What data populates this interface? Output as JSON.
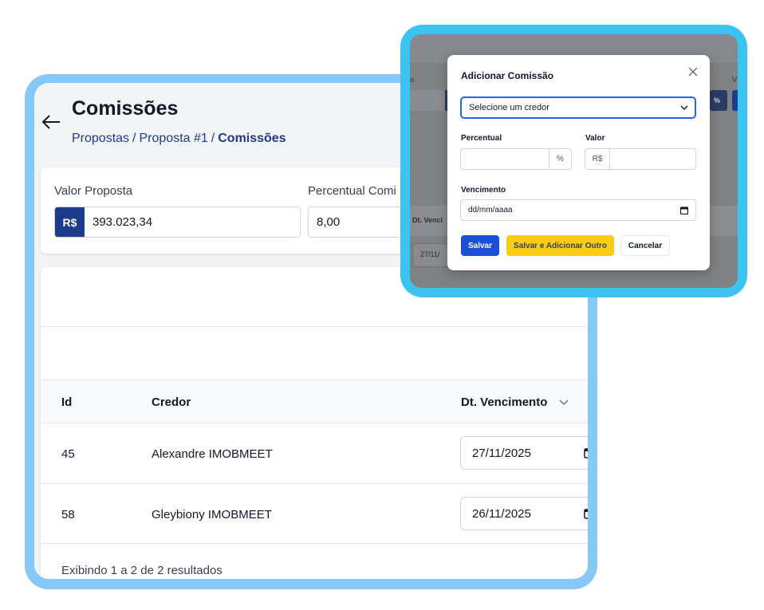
{
  "page": {
    "title": "Comissões",
    "breadcrumb": {
      "items": [
        "Propostas",
        "Proposta #1"
      ],
      "separator": "/",
      "current": "Comissões"
    }
  },
  "summary": {
    "valor_proposta_label": "Valor Proposta",
    "currency_addon": "R$",
    "valor_proposta_value": "393.023,34",
    "percentual_label": "Percentual Comi",
    "percentual_value": "8,00"
  },
  "table": {
    "columns": [
      "Id",
      "Credor",
      "Dt. Vencimento"
    ],
    "rows": [
      {
        "id": "45",
        "credor": "Alexandre IMOBMEET",
        "vencimento": "27/11/2025"
      },
      {
        "id": "58",
        "credor": "Gleybiony IMOBMEET",
        "vencimento": "26/11/2025"
      }
    ],
    "footer": "Exibindo 1 a 2 de 2 resultados"
  },
  "modal": {
    "background": {
      "left_fragment": "o",
      "right_fragment": "V",
      "percent_addon": "%",
      "column_fragment": "Dt. Venci",
      "date_fragment": "27/11/"
    },
    "title": "Adicionar Comissão",
    "credor_placeholder": "Selecione um credor",
    "percentual_label": "Percentual",
    "percentual_addon": "%",
    "valor_label": "Valor",
    "valor_addon": "R$",
    "vencimento_label": "Vencimento",
    "vencimento_placeholder": "dd/mm/aaaa",
    "buttons": {
      "save": "Salvar",
      "save_add": "Salvar e Adicionar Outro",
      "cancel": "Cancelar"
    }
  },
  "colors": {
    "frame_back": "#86c9f8",
    "frame_modal": "#3bc4f2",
    "brand_navy": "#1e3a8a",
    "primary": "#1d4ed8",
    "warning": "#facc15"
  },
  "icons": [
    "arrow-left-icon",
    "sort-chevron-down-icon",
    "calendar-icon",
    "close-icon",
    "chevron-down-icon"
  ]
}
